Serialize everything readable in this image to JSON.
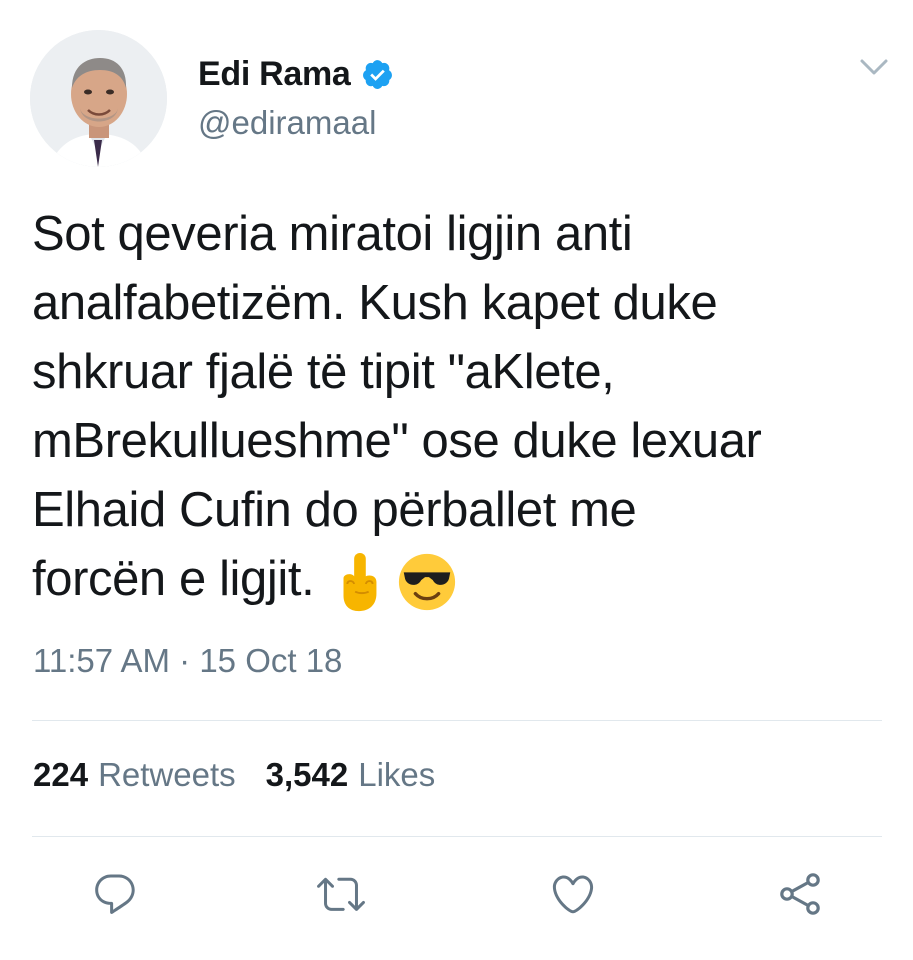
{
  "author": {
    "display_name": "Edi Rama",
    "handle": "@ediramaal",
    "verified": true,
    "avatar_icon": "profile-photo"
  },
  "tweet": {
    "lines": [
      "Sot qeveria miratoi ligjin anti",
      "analfabetizëm. Kush kapet duke",
      "shkruar fjalë të tipit \"aKlete,",
      "mBrekullueshme\" ose duke lexuar",
      "Elhaid Cufin do përballet me",
      "forcën e ligjit."
    ],
    "emojis": [
      "middle-finger-emoji",
      "sunglasses-face-emoji"
    ],
    "time": "11:57 AM",
    "separator": "·",
    "date": "15 Oct 18"
  },
  "stats": {
    "retweets_count": "224",
    "retweets_label": "Retweets",
    "likes_count": "3,542",
    "likes_label": "Likes"
  },
  "actions": [
    "reply-icon",
    "retweet-icon",
    "like-icon",
    "share-icon"
  ],
  "colors": {
    "text": "#14171a",
    "secondary": "#657786",
    "verified": "#1da1f2",
    "divider": "#e1e8ed"
  }
}
